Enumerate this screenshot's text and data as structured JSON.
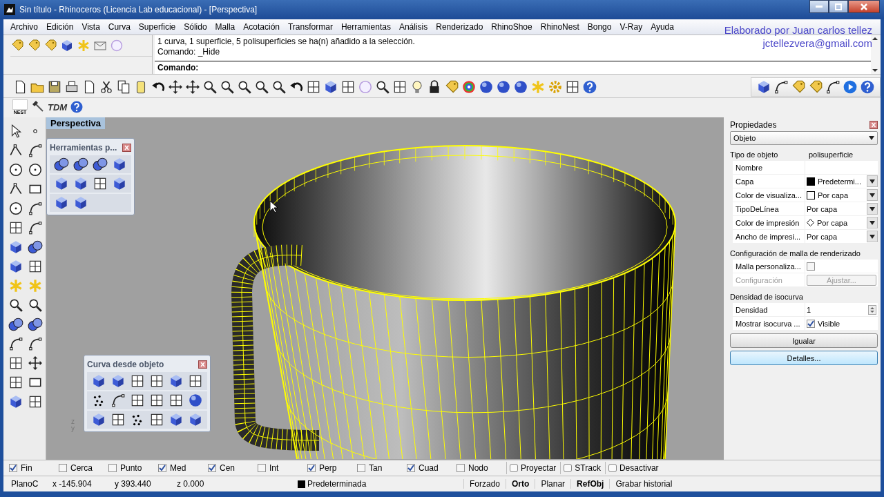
{
  "window": {
    "title": "Sin título - Rhinoceros (Licencia Lab educacional) - [Perspectiva]"
  },
  "menu": [
    "Archivo",
    "Edición",
    "Vista",
    "Curva",
    "Superficie",
    "Sólido",
    "Malla",
    "Acotación",
    "Transformar",
    "Herramientas",
    "Análisis",
    "Renderizado",
    "RhinoShoe",
    "RhinoNest",
    "Bongo",
    "V-Ray",
    "Ayuda"
  ],
  "author_credit": {
    "name_line": "Elaborado por Juan carlos tellez",
    "email": "jctellezvera@gmail.com"
  },
  "command": {
    "history": [
      "1 curva, 1 superficie, 5 polisuperficies se ha(n) añadido a la selección.",
      "Comando: _Hide"
    ],
    "prompt": "Comando:"
  },
  "plugin_toolbar": {
    "labels": [
      "NEST",
      "TDM"
    ]
  },
  "viewport": {
    "title": "Perspectiva",
    "axis_labels": [
      "z",
      "y"
    ]
  },
  "floating_toolbars": [
    {
      "title": "Herramientas p..."
    },
    {
      "title": "Curva desde objeto"
    }
  ],
  "properties": {
    "title": "Propiedades",
    "selector": "Objeto",
    "sections": [
      {
        "heading": "Tipo de objeto",
        "value": "polisuperficie",
        "rows": [
          {
            "label": "Nombre",
            "kind": "text"
          },
          {
            "label": "Capa",
            "kind": "dropdown",
            "value": "Predetermi...",
            "color": "#000000"
          },
          {
            "label": "Color de visualiza...",
            "kind": "dropdown",
            "value": "Por capa",
            "color": "#ffffff"
          },
          {
            "label": "TipoDeLínea",
            "kind": "dropdown",
            "value": "Por capa"
          },
          {
            "label": "Color de impresión",
            "kind": "diamond-dropdown",
            "value": "Por capa"
          },
          {
            "label": "Ancho de impresi...",
            "kind": "dropdown",
            "value": "Por capa"
          }
        ]
      },
      {
        "heading": "Configuración de malla de renderizado",
        "rows": [
          {
            "label": "Malla personaliza...",
            "kind": "checkbox",
            "checked": false
          },
          {
            "label": "Configuración",
            "kind": "button",
            "value": "Ajustar...",
            "disabled": true
          }
        ]
      },
      {
        "heading": "Densidad de isocurva",
        "rows": [
          {
            "label": "Densidad",
            "kind": "spinner",
            "value": "1"
          },
          {
            "label": "Mostrar isocurva ...",
            "kind": "checkbox",
            "checked": true,
            "value": "Visible"
          }
        ]
      }
    ],
    "buttons": [
      {
        "label": "Igualar",
        "default": false
      },
      {
        "label": "Detalles...",
        "default": true
      }
    ]
  },
  "osnap": [
    {
      "label": "Fin",
      "kind": "checkbox",
      "checked": true
    },
    {
      "label": "Cerca",
      "kind": "checkbox",
      "checked": false
    },
    {
      "label": "Punto",
      "kind": "checkbox",
      "checked": false
    },
    {
      "label": "Med",
      "kind": "checkbox",
      "checked": true
    },
    {
      "label": "Cen",
      "kind": "checkbox",
      "checked": true
    },
    {
      "label": "Int",
      "kind": "checkbox",
      "checked": false
    },
    {
      "label": "Perp",
      "kind": "checkbox",
      "checked": true
    },
    {
      "label": "Tan",
      "kind": "checkbox",
      "checked": false
    },
    {
      "label": "Cuad",
      "kind": "checkbox",
      "checked": true
    },
    {
      "label": "Nodo",
      "kind": "checkbox",
      "checked": false
    },
    {
      "label": "Proyectar",
      "kind": "toggle",
      "checked": false
    },
    {
      "label": "STrack",
      "kind": "toggle",
      "checked": false
    },
    {
      "label": "Desactivar",
      "kind": "toggle",
      "checked": false
    }
  ],
  "status_bar": [
    {
      "kind": "text",
      "text": "PlanoC"
    },
    {
      "kind": "coord",
      "text": "x -145.904"
    },
    {
      "kind": "coord",
      "text": "y 393.440"
    },
    {
      "kind": "coord",
      "text": "z 0.000"
    },
    {
      "kind": "layer",
      "text": "Predeterminada",
      "color": "#000000"
    },
    {
      "kind": "toggle",
      "text": "Forzado",
      "on": false
    },
    {
      "kind": "toggle",
      "text": "Orto",
      "on": true
    },
    {
      "kind": "toggle",
      "text": "Planar",
      "on": false
    },
    {
      "kind": "toggle",
      "text": "RefObj",
      "on": true
    },
    {
      "kind": "toggle",
      "text": "Grabar historial",
      "on": false
    }
  ]
}
